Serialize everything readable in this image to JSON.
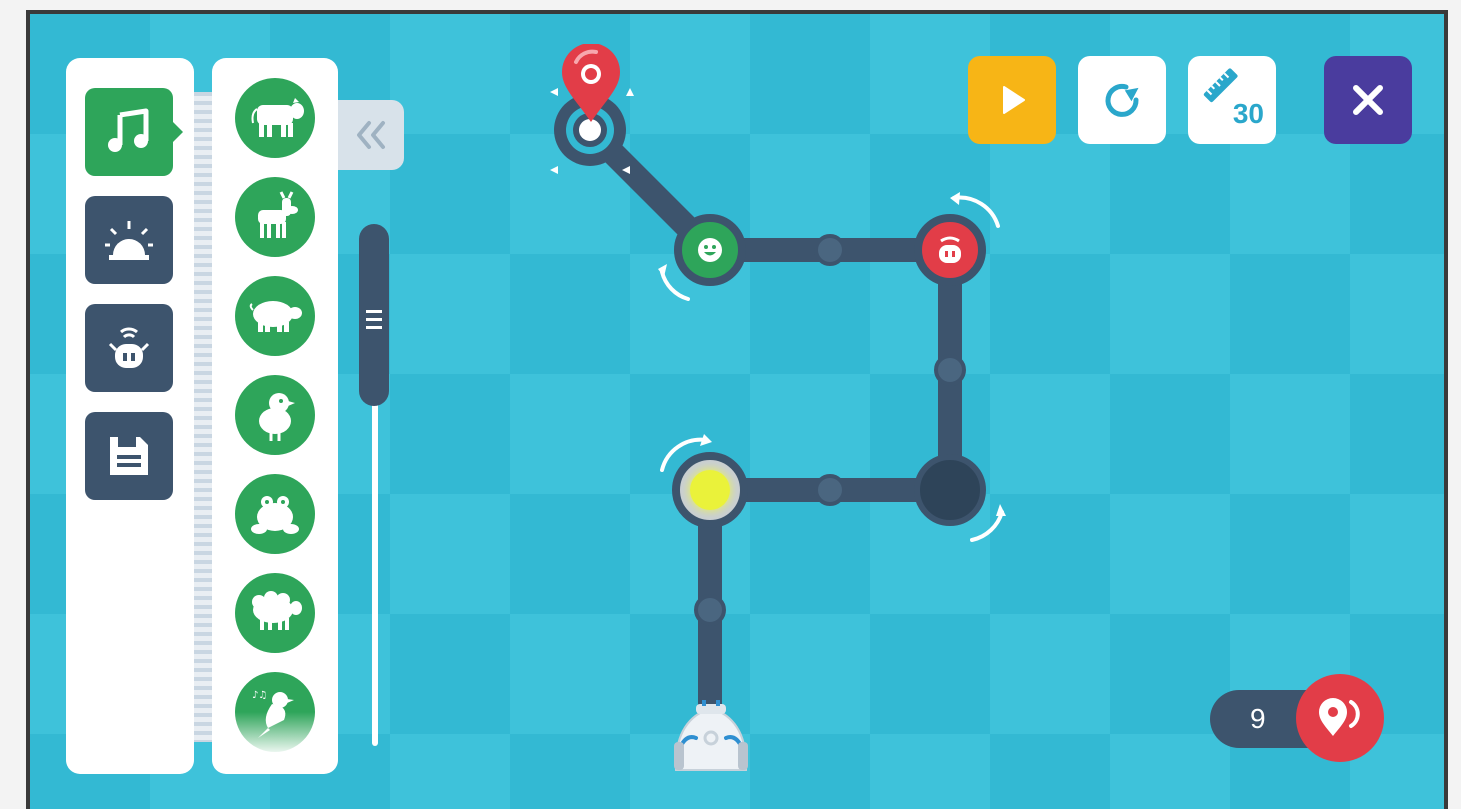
{
  "toolbar": {
    "play_icon": "play-icon",
    "redo_icon": "redo-icon",
    "ruler_value": "30",
    "close_icon": "close-icon"
  },
  "categories": [
    {
      "name": "music",
      "icon": "music-note-icon",
      "active": true
    },
    {
      "name": "alarm",
      "icon": "siren-icon",
      "active": false
    },
    {
      "name": "robot",
      "icon": "robot-signal-icon",
      "active": false
    },
    {
      "name": "save",
      "icon": "save-icon",
      "active": false
    }
  ],
  "items": [
    "cow-icon",
    "goat-icon",
    "pig-icon",
    "chick-icon",
    "frog-icon",
    "sheep-icon",
    "bird-icon"
  ],
  "collapse_icon": "double-chevron-left-icon",
  "counter": {
    "value": "9",
    "icon": "location-icon"
  },
  "colors": {
    "board": "#33b9d3",
    "board_alt": "#3ec2da",
    "path": "#3d546d",
    "green": "#2ea55a",
    "red": "#e23d48",
    "yellow": "#f7b516",
    "purple": "#4a3c9e"
  }
}
